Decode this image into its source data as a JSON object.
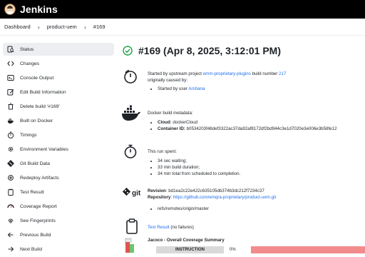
{
  "header": {
    "brand": "Jenkins"
  },
  "breadcrumb": [
    "Dashboard",
    "product-uem",
    "#169"
  ],
  "sidebar": {
    "items": [
      {
        "label": "Status",
        "icon": "search-document-icon"
      },
      {
        "label": "Changes",
        "icon": "code-icon"
      },
      {
        "label": "Console Output",
        "icon": "terminal-icon"
      },
      {
        "label": "Edit Build Information",
        "icon": "edit-icon"
      },
      {
        "label": "Delete build ‘#169’",
        "icon": "trash-icon"
      },
      {
        "label": "Built on Docker",
        "icon": "docker-icon"
      },
      {
        "label": "Timings",
        "icon": "stopwatch-icon"
      },
      {
        "label": "Environment Variables",
        "icon": "gear-icon"
      },
      {
        "label": "Git Build Data",
        "icon": "git-icon"
      },
      {
        "label": "Redeploy Artifacts",
        "icon": "redeploy-icon"
      },
      {
        "label": "Test Result",
        "icon": "clipboard-icon"
      },
      {
        "label": "Coverage Report",
        "icon": "gauge-icon"
      },
      {
        "label": "See Fingerprints",
        "icon": "fingerprint-icon"
      },
      {
        "label": "Previous Build",
        "icon": "arrow-left-icon"
      },
      {
        "label": "Next Build",
        "icon": "arrow-right-icon"
      }
    ]
  },
  "build": {
    "title": "#169 (Apr 8, 2025, 3:12:01 PM)",
    "status_color": "#1ea446"
  },
  "cause": {
    "prefix": "Started by upstream project ",
    "project": "emm-proprietary-plugins",
    "middle": " build number ",
    "number": "217",
    "line2": "originally caused by:",
    "user_prefix": "Started by user ",
    "user": "Arshana"
  },
  "docker": {
    "heading": "Docker build metadata:",
    "cloud_label": "Cloud:",
    "cloud_value": " dockerCloud",
    "container_label": "Container ID:",
    "container_value": " b0534203f48def3322ac37da92af8172df2bd944c3e1d7020e3e006e3b58fe12"
  },
  "timing": {
    "heading": "This run spent:",
    "items": [
      "34 sec waiting;",
      "33 min build duration;",
      "34 min total from scheduled to completion."
    ]
  },
  "git": {
    "revision_label": "Revision",
    "revision_value": ": bd1ea2c22e422c635105db374b3dc212f7234c37",
    "repository_label": "Repository",
    "repository_sep": ": ",
    "repository_url": "https://github.com/emqra-proprietary/product-uem.git",
    "ref": "refs/remotes/origin/master"
  },
  "tests": {
    "link": "Test Result",
    "suffix": " (no failures)"
  },
  "coverage": {
    "title": "Jacoco - Overall Coverage Summary",
    "metric": "INSTRUCTION",
    "percent_label": "0%",
    "percent": 0
  }
}
